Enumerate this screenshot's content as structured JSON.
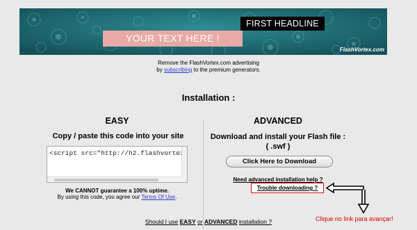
{
  "banner": {
    "headline": "FIRST HEADLINE",
    "your_text": "YOUR TEXT HERE !",
    "brand": "FlashVortex.com"
  },
  "ad_note": {
    "line1": "Remove the FlashVortex.com advertising",
    "line2_prefix": "by",
    "line2_link": "subscribing",
    "line2_suffix": "to the premium generators."
  },
  "installation_title": "Installation :",
  "easy": {
    "title": "EASY",
    "subtitle": "Copy / paste this code into your site",
    "code": "<script src=\"http://h2.flashvortex",
    "warning": "We CANNOT guarantee a 100% uptime.",
    "agree_prefix": "By using this code, you agree our",
    "agree_link": "Terms Of Use",
    "agree_suffix": "."
  },
  "advanced": {
    "title": "ADVANCED",
    "subtitle_line1": "Download and install your Flash file :",
    "subtitle_line2": "( .swf )",
    "download_button": "Click Here to Download",
    "need_help": "Need advanced installation help ?",
    "trouble": "Trouble downloading ?"
  },
  "annotation": {
    "clique": "Clique no link para avançar!"
  },
  "bottom": {
    "prefix": "Should I use",
    "easy": "EASY",
    "middle": "or",
    "advanced": "ADVANCED",
    "suffix": "installation ?"
  },
  "colors": {
    "banner_teal": "#1f6f78",
    "pink_box": "#e8aaa6",
    "link_blue": "#2a3cc7",
    "highlight_red": "#dd1111",
    "page_bg": "#e9e9e9"
  }
}
